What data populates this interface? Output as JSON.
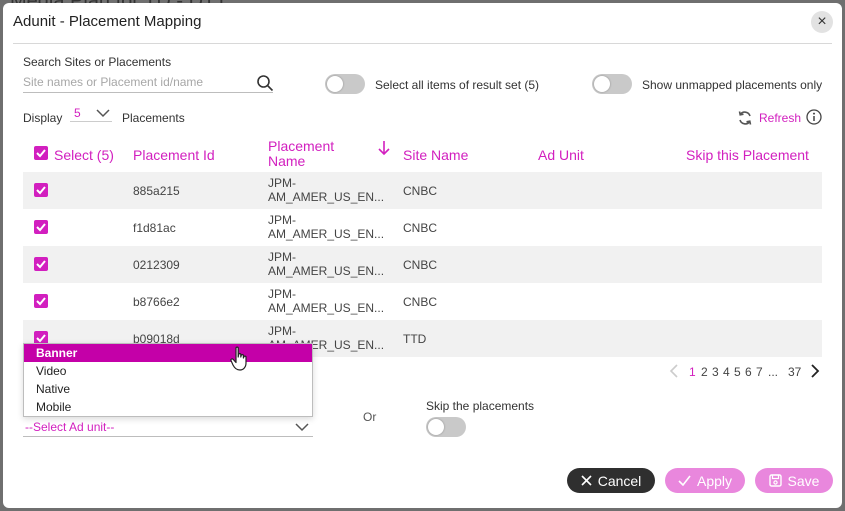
{
  "background": {
    "title": "Media Plan for TD - DTT"
  },
  "modal": {
    "title": "Adunit - Placement Mapping",
    "close_symbol": "×"
  },
  "search": {
    "label": "Search Sites or Placements",
    "placeholder": "Site names or Placement id/name",
    "value": ""
  },
  "toggles": {
    "select_all_label": "Select all items of result set (5)",
    "select_all_on": false,
    "unmapped_label": "Show unmapped placements only",
    "unmapped_on": false
  },
  "display": {
    "label": "Display",
    "value": "5",
    "suffix": "Placements"
  },
  "refresh_label": "Refresh",
  "table": {
    "headers": {
      "select": "Select (5)",
      "placement_id": "Placement Id",
      "placement_name": "Placement Name",
      "site_name": "Site Name",
      "ad_unit": "Ad Unit",
      "skip": "Skip this Placement"
    },
    "rows": [
      {
        "id": "885a215",
        "name_line1": "JPM-",
        "name_line2": "AM_AMER_US_EN...",
        "site": "CNBC",
        "checked": true
      },
      {
        "id": "f1d81ac",
        "name_line1": "JPM-",
        "name_line2": "AM_AMER_US_EN...",
        "site": "CNBC",
        "checked": true
      },
      {
        "id": "0212309",
        "name_line1": "JPM-",
        "name_line2": "AM_AMER_US_EN...",
        "site": "CNBC",
        "checked": true
      },
      {
        "id": "b8766e2",
        "name_line1": "JPM-",
        "name_line2": "AM_AMER_US_EN...",
        "site": "CNBC",
        "checked": true
      },
      {
        "id": "b09018d",
        "name_line1": "JPM-",
        "name_line2": "AM_AMER_US_EN...",
        "site": "TTD",
        "checked": true
      }
    ]
  },
  "pagination": {
    "pages": [
      "1",
      "2",
      "3",
      "4",
      "5",
      "6",
      "7"
    ],
    "ellipsis": "...",
    "last": "37",
    "current": "1"
  },
  "adunit_dropdown": {
    "options": [
      "Banner",
      "Video",
      "Native",
      "Mobile"
    ],
    "highlighted": "Banner",
    "placeholder": "--Select Ad unit--"
  },
  "or_label": "Or",
  "skip_label": "Skip the placements",
  "buttons": {
    "cancel": "Cancel",
    "apply": "Apply",
    "save": "Save"
  },
  "colors": {
    "accent": "#d21fbf",
    "dropdown_highlight": "#c400a8",
    "button_disabled": "#e987dd",
    "cancel": "#2f2f2f"
  }
}
